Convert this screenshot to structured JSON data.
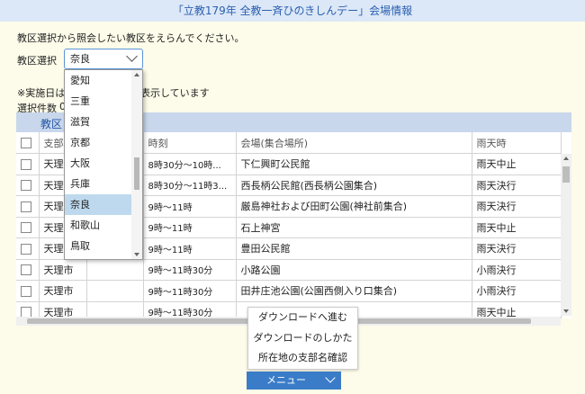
{
  "header": {
    "title": "「立教179年 全教一斉ひのきしんデー」会場情報"
  },
  "instruction": "教区選択から照会したい教区をえらんでください。",
  "district_select": {
    "label": "教区選択",
    "value": "奈良",
    "options": [
      "愛知",
      "三重",
      "滋賀",
      "京都",
      "大阪",
      "兵庫",
      "奈良",
      "和歌山",
      "鳥取"
    ],
    "selected_index": 6
  },
  "note": {
    "start": "※実施日は",
    "end": "表示しています"
  },
  "count": {
    "label": "選択件数",
    "value_fragment": "0"
  },
  "tab_label": "教区",
  "table": {
    "headers": [
      "",
      "支部",
      "",
      "時刻",
      "会場(集合場所)",
      "雨天時"
    ],
    "rows": [
      [
        "天理市",
        "",
        "8時30分～10時...",
        "下仁興町公民館",
        "雨天中止"
      ],
      [
        "天理市",
        "",
        "8時30分～11時3...",
        "西長柄公民館(西長柄公園集合)",
        "雨天決行"
      ],
      [
        "天理市",
        "",
        "9時～11時",
        "厳島神社および田町公園(神社前集合)",
        "雨天決行"
      ],
      [
        "天理市",
        "",
        "9時～11時",
        "石上神宮",
        "雨天中止"
      ],
      [
        "天理市",
        "",
        "9時～11時",
        "豊田公民館",
        "雨天決行"
      ],
      [
        "天理市",
        "",
        "9時～11時30分",
        "小路公園",
        "小雨決行"
      ],
      [
        "天理市",
        "",
        "9時～11時30分",
        "田井庄池公園(公園西側入り口集合)",
        "小雨決行"
      ],
      [
        "天理市",
        "",
        "9時～11時30分",
        "",
        "雨天中止"
      ]
    ]
  },
  "menu": {
    "items": [
      "ダウンロードへ進む",
      "ダウンロードのしかた",
      "所在地の支部名確認"
    ],
    "button_label": "メニュー"
  }
}
